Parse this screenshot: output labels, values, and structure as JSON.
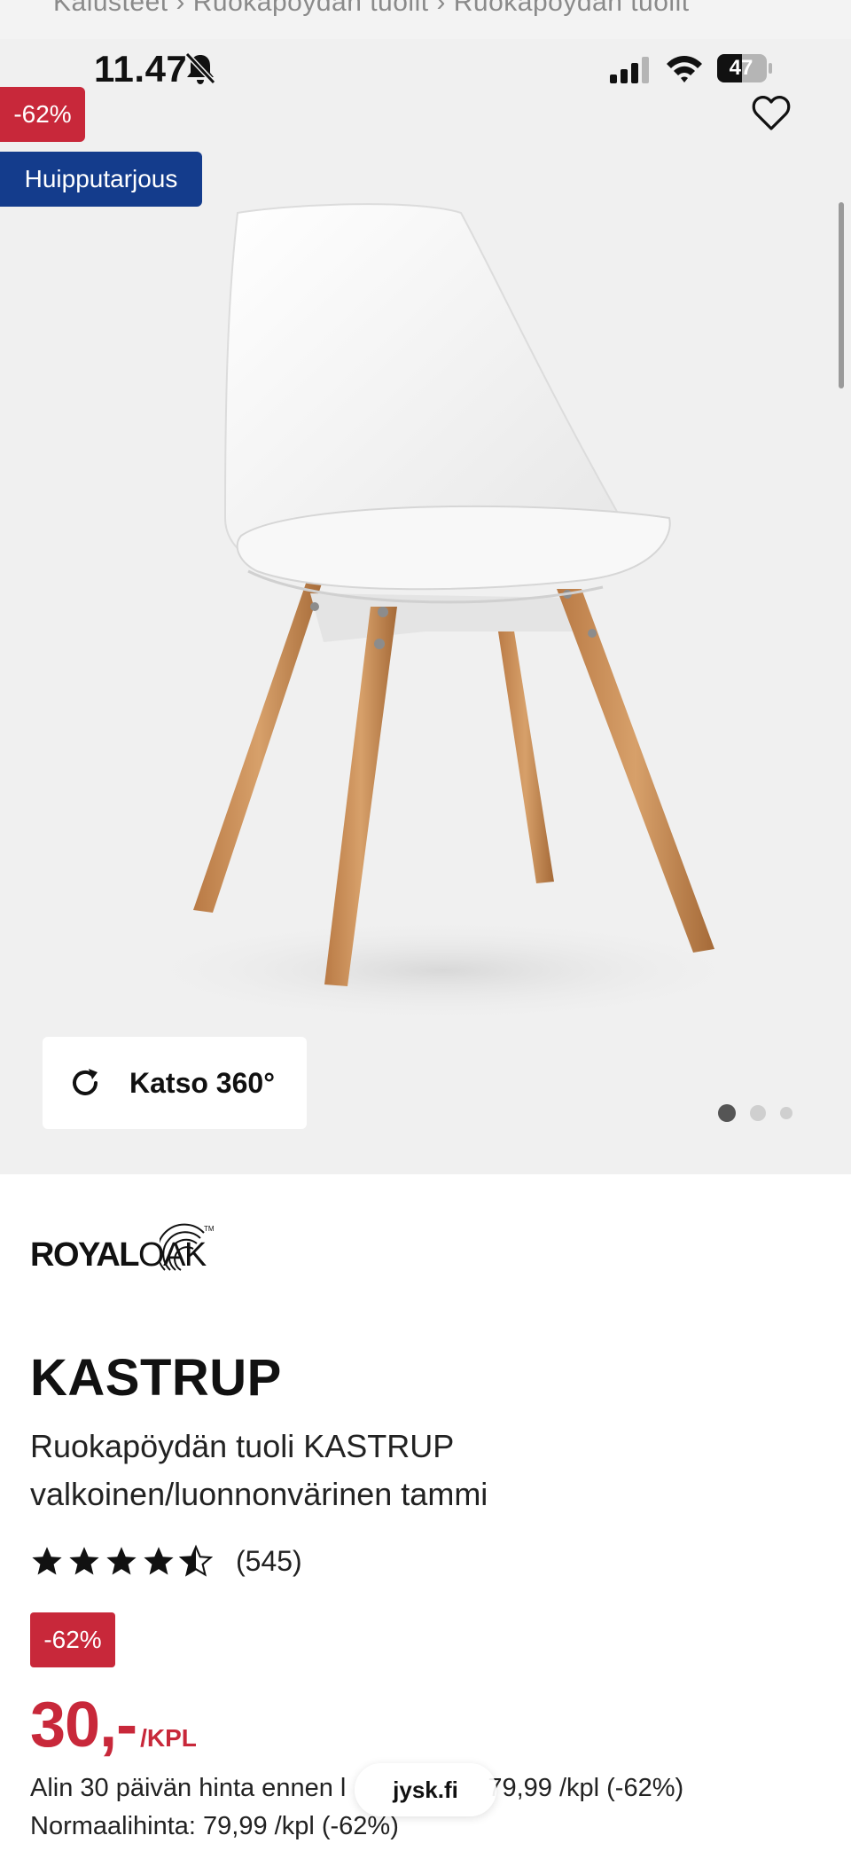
{
  "browser": {
    "breadcrumb_partial": "Kalusteet   ›   Ruokapöydän tuolit   ›   Ruokapöydän tuolit",
    "url": "jysk.fi"
  },
  "status_bar": {
    "time": "11.47",
    "battery": "47",
    "icons": [
      "bell-slash-icon",
      "signal-icon",
      "wifi-icon",
      "battery-icon"
    ]
  },
  "hero": {
    "discount_badge": "-62%",
    "deal_badge": "Huipputarjous",
    "view360_label": "Katso 360°",
    "slides": {
      "count": 3,
      "active_index": 0
    },
    "favorite_icon": "heart-outline-icon"
  },
  "product": {
    "brand": "ROYALOAK",
    "brand_parts": {
      "bold": "ROYAL",
      "light": "OAK"
    },
    "name": "KASTRUP",
    "description": "Ruokapöydän tuoli KASTRUP valkoinen/luonnonvärinen tammi",
    "rating_value": 4.5,
    "rating_max": 5,
    "review_count": "(545)",
    "discount_badge": "-62%",
    "price": "30,-",
    "price_unit": "/KPL",
    "lowest_price_note_start": "Alin 30 päivän hinta ennen l",
    "lowest_price_note_end": "79,99 /kpl (-62%)",
    "normal_price": "Normaalihinta: 79,99 /kpl (-62%)"
  },
  "colors": {
    "accent_red": "#c8283a",
    "deal_blue": "#143c8c",
    "hero_background": "#f0f0f0"
  }
}
